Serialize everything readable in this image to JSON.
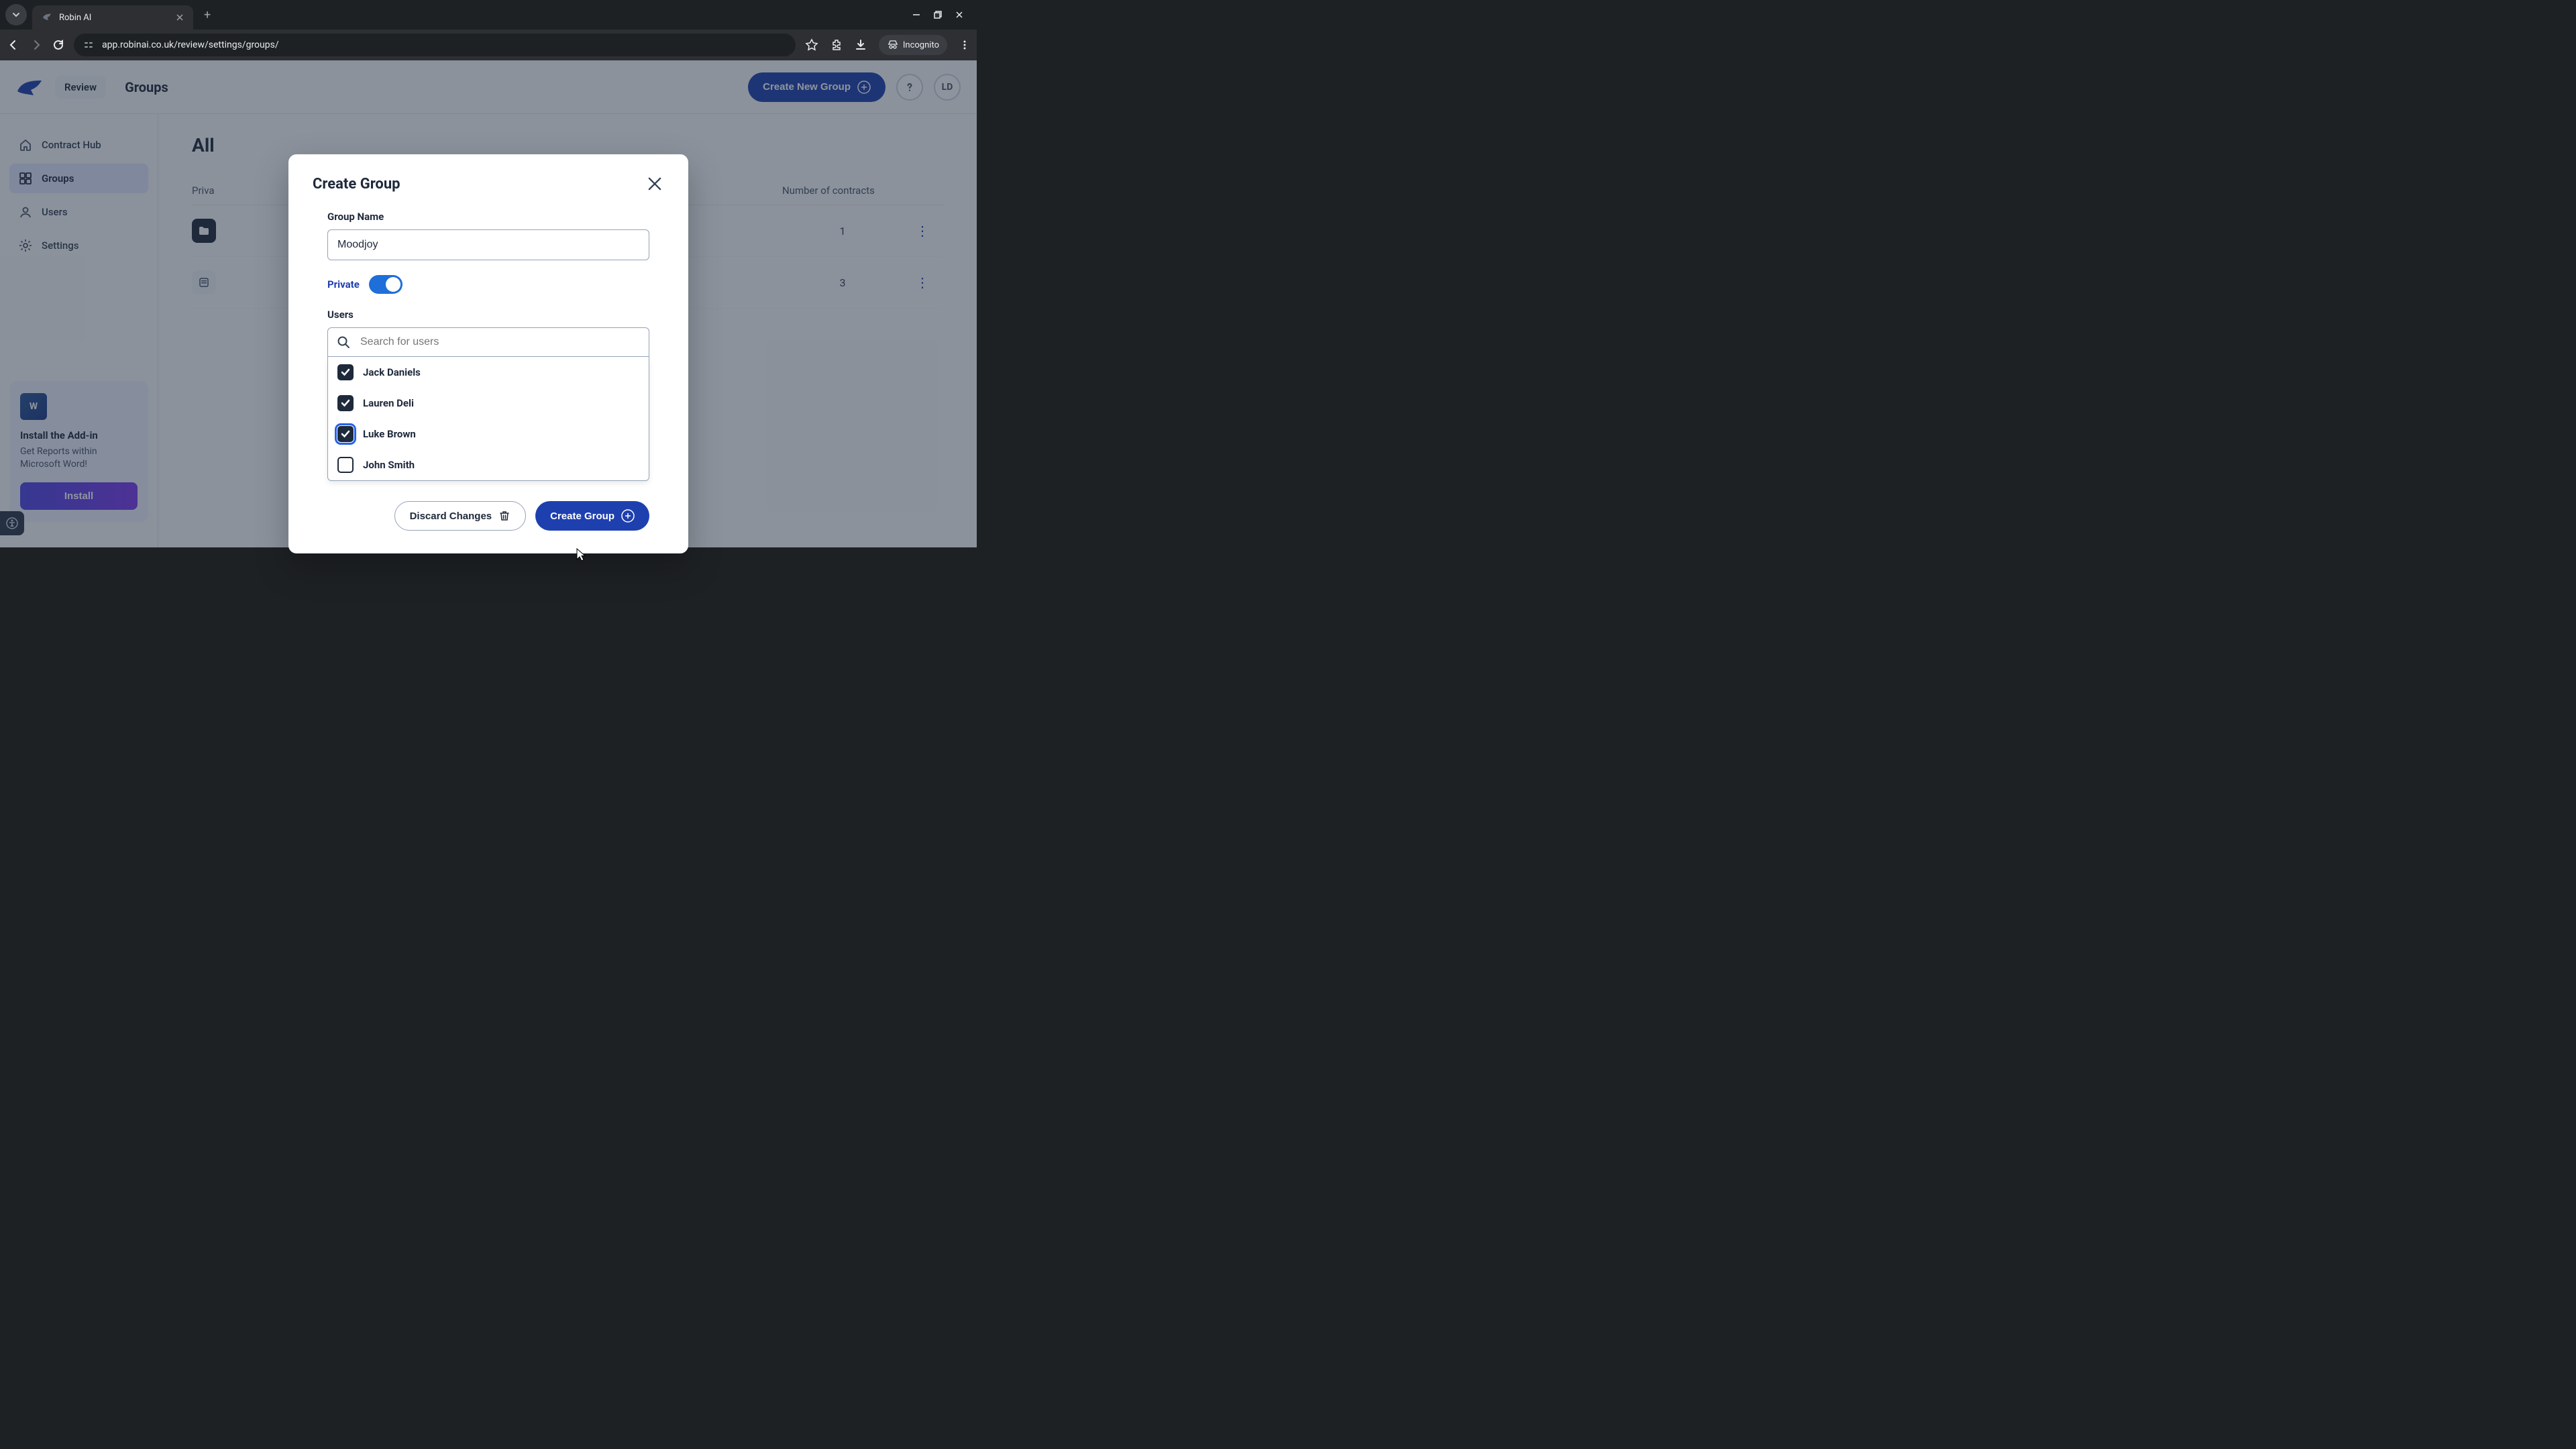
{
  "browser": {
    "tab_title": "Robin AI",
    "url": "app.robinai.co.uk/review/settings/groups/",
    "incognito_label": "Incognito"
  },
  "header": {
    "review_label": "Review",
    "page_name": "Groups",
    "create_button": "Create New Group",
    "avatar_initials": "LD"
  },
  "sidebar": {
    "items": [
      {
        "label": "Contract Hub"
      },
      {
        "label": "Groups"
      },
      {
        "label": "Users"
      },
      {
        "label": "Settings"
      }
    ],
    "promo": {
      "icon_text": "W",
      "title": "Install the Add-in",
      "text": "Get Reports within Microsoft Word!",
      "button": "Install"
    }
  },
  "content": {
    "title": "All",
    "columns": {
      "private": "Priva",
      "contracts": "Number of contracts"
    },
    "rows": [
      {
        "contracts": "1"
      },
      {
        "contracts": "3"
      }
    ]
  },
  "modal": {
    "title": "Create Group",
    "group_name_label": "Group Name",
    "group_name_value": "Moodjoy",
    "private_label": "Private",
    "private_on": true,
    "users_label": "Users",
    "search_placeholder": "Search for users",
    "users": [
      {
        "name": "Jack Daniels",
        "checked": true,
        "focus": false
      },
      {
        "name": "Lauren Deli",
        "checked": true,
        "focus": false
      },
      {
        "name": "Luke Brown",
        "checked": true,
        "focus": true
      },
      {
        "name": "John Smith",
        "checked": false,
        "focus": false
      }
    ],
    "discard_label": "Discard Changes",
    "create_label": "Create Group"
  }
}
